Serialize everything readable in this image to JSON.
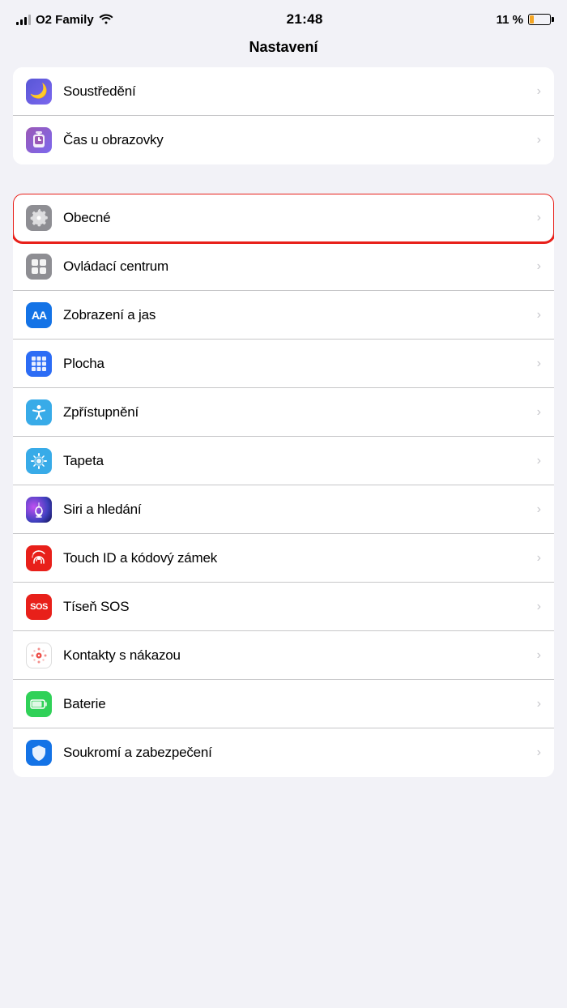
{
  "statusBar": {
    "carrier": "O2 Family",
    "wifi": true,
    "time": "21:48",
    "battery": "11 %"
  },
  "pageTitle": "Nastavení",
  "topGroup": [
    {
      "id": "soustredenı",
      "label": "Soustředění",
      "iconBg": "purple",
      "iconType": "moon"
    },
    {
      "id": "cas",
      "label": "Čas u obrazovky",
      "iconBg": "purple2",
      "iconType": "hourglass"
    }
  ],
  "mainGroup": [
    {
      "id": "obecne",
      "label": "Obecné",
      "iconBg": "gray",
      "iconType": "gear",
      "highlighted": true
    },
    {
      "id": "ovladaci",
      "label": "Ovládací centrum",
      "iconBg": "gray",
      "iconType": "toggle"
    },
    {
      "id": "zobrazeni",
      "label": "Zobrazení a jas",
      "iconBg": "blue",
      "iconType": "AA"
    },
    {
      "id": "plocha",
      "label": "Plocha",
      "iconBg": "colorful",
      "iconType": "grid"
    },
    {
      "id": "zpristupneni",
      "label": "Zpřístupnění",
      "iconBg": "lightblue",
      "iconType": "accessibility"
    },
    {
      "id": "tapeta",
      "label": "Tapeta",
      "iconBg": "lightblue2",
      "iconType": "flower"
    },
    {
      "id": "siri",
      "label": "Siri a hledání",
      "iconBg": "siri",
      "iconType": "siri"
    },
    {
      "id": "touchid",
      "label": "Touch ID a kódový zámek",
      "iconBg": "red",
      "iconType": "fingerprint"
    },
    {
      "id": "tisen",
      "label": "Tíseň SOS",
      "iconBg": "sosred",
      "iconType": "sos"
    },
    {
      "id": "kontakty",
      "label": "Kontakty s nákazou",
      "iconBg": "covid",
      "iconType": "covid"
    },
    {
      "id": "baterie",
      "label": "Baterie",
      "iconBg": "green",
      "iconType": "battery"
    },
    {
      "id": "soukromi",
      "label": "Soukromí a zabezpečení",
      "iconBg": "darkblue",
      "iconType": "hand"
    }
  ]
}
